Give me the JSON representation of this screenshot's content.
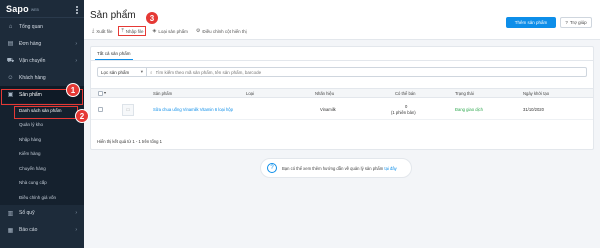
{
  "brand": {
    "logo": "Sapo",
    "logo_sub": "WEB"
  },
  "sidebar": {
    "items": [
      {
        "label": "Tổng quan",
        "icon": "home-icon"
      },
      {
        "label": "Đơn hàng",
        "icon": "cart-icon"
      },
      {
        "label": "Vận chuyển",
        "icon": "truck-icon"
      },
      {
        "label": "Khách hàng",
        "icon": "user-icon"
      },
      {
        "label": "Sản phẩm",
        "icon": "box-icon"
      }
    ],
    "sub_items": [
      {
        "label": "Danh sách sản phẩm"
      },
      {
        "label": "Quản lý kho"
      },
      {
        "label": "Nhập hàng"
      },
      {
        "label": "Kiểm hàng"
      },
      {
        "label": "Chuyển hàng"
      },
      {
        "label": "Nhà cung cấp"
      },
      {
        "label": "Điều chỉnh giá vốn"
      }
    ],
    "bottom_items": [
      {
        "label": "Sổ quỹ",
        "icon": "wallet-icon"
      },
      {
        "label": "Báo cáo",
        "icon": "chart-icon"
      }
    ]
  },
  "header": {
    "title": "Sản phẩm",
    "toolbar": {
      "export": "Xuất file",
      "import": "Nhập file",
      "categories": "Loại sản phẩm",
      "adjust_cols": "Điều chỉnh cột hiển thị"
    },
    "add_button": "Thêm sản phẩm",
    "help_button": "Trợ giúp"
  },
  "list": {
    "tab": "Tất cả sản phẩm",
    "filter_label": "Lọc sản phẩm",
    "search_placeholder": "Tìm kiếm theo mã sản phẩm, tên sản phẩm, barcode",
    "columns": [
      "Sản phẩm",
      "Loại",
      "Nhãn hiệu",
      "Có thể bán",
      "Trạng thái",
      "Ngày khởi tạo"
    ],
    "rows": [
      {
        "name": "Sữa chua uống Vinamilk Vitamin 6 loại hộp",
        "type": "",
        "brand": "Vinamilk",
        "available": "0",
        "variants": "(1 phiên bản)",
        "status": "Đang giao dịch",
        "created": "31/10/2020"
      }
    ],
    "result_text": "Hiển thị kết quả từ 1 - 1 trên tổng 1"
  },
  "hint": {
    "text": "Bạn có thể xem thêm hướng dẫn về quản lý sản phẩm",
    "link": "tại đây"
  },
  "badges": [
    "1",
    "2",
    "3"
  ],
  "colors": {
    "accent": "#0d8ee9",
    "sidebar_bg": "#1d2b3a",
    "highlight": "#e53935",
    "status_green": "#2fa84f"
  }
}
